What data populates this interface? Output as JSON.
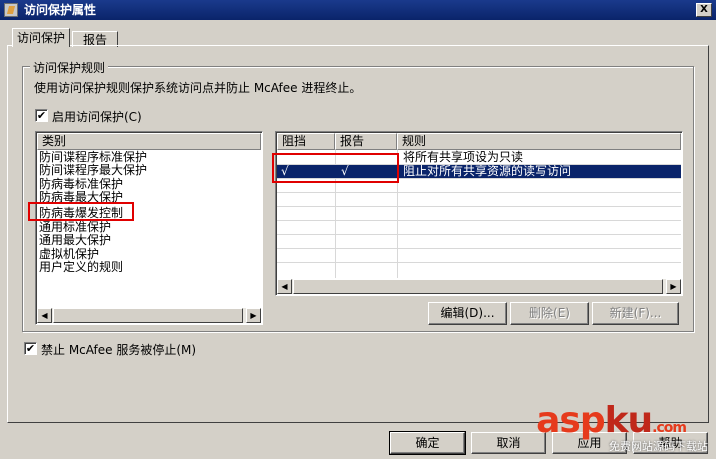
{
  "window": {
    "title": "访问保护属性",
    "close_glyph": "X"
  },
  "tabs": [
    {
      "label": "访问保护",
      "active": true
    },
    {
      "label": "报告",
      "active": false
    }
  ],
  "group": {
    "title": "访问保护规则",
    "description": "使用访问保护规则保护系统访问点并防止 McAfee 进程终止。"
  },
  "enable_protection": {
    "label": "启用访问保护(C)",
    "checked": true,
    "check_glyph": "✔"
  },
  "categories": {
    "header": "类别",
    "items": [
      "防间谍程序标准保护",
      "防间谍程序最大保护",
      "防病毒标准保护",
      "防病毒最大保护",
      "防病毒爆发控制",
      "通用标准保护",
      "通用最大保护",
      "虚拟机保护",
      "用户定义的规则"
    ],
    "highlighted_index": 4
  },
  "rules": {
    "columns": [
      "阻挡",
      "报告",
      "规则"
    ],
    "rows": [
      {
        "block": "",
        "report": "",
        "rule": "将所有共享项设为只读",
        "selected": false
      },
      {
        "block": "√",
        "report": "√",
        "rule": "阻止对所有共享资源的读写访问",
        "selected": true
      }
    ]
  },
  "rule_buttons": {
    "edit": "编辑(D)...",
    "delete": "删除(E)",
    "new": "新建(F)..."
  },
  "prevent_stop": {
    "label": "禁止 McAfee 服务被停止(M)",
    "checked": true,
    "check_glyph": "✔"
  },
  "footer_buttons": {
    "ok": "确定",
    "cancel": "取消",
    "apply": "应用",
    "help": "帮助"
  },
  "scroll_glyphs": {
    "left": "◀",
    "right": "▶"
  },
  "watermark": {
    "brand_a": "asp",
    "brand_b": "ku",
    "tld": ".com",
    "sub": "免费网站源码下载站"
  },
  "colors": {
    "selection": "#0a246a",
    "highlight_box": "#e00000",
    "dialog_bg": "#d4d0c8"
  }
}
